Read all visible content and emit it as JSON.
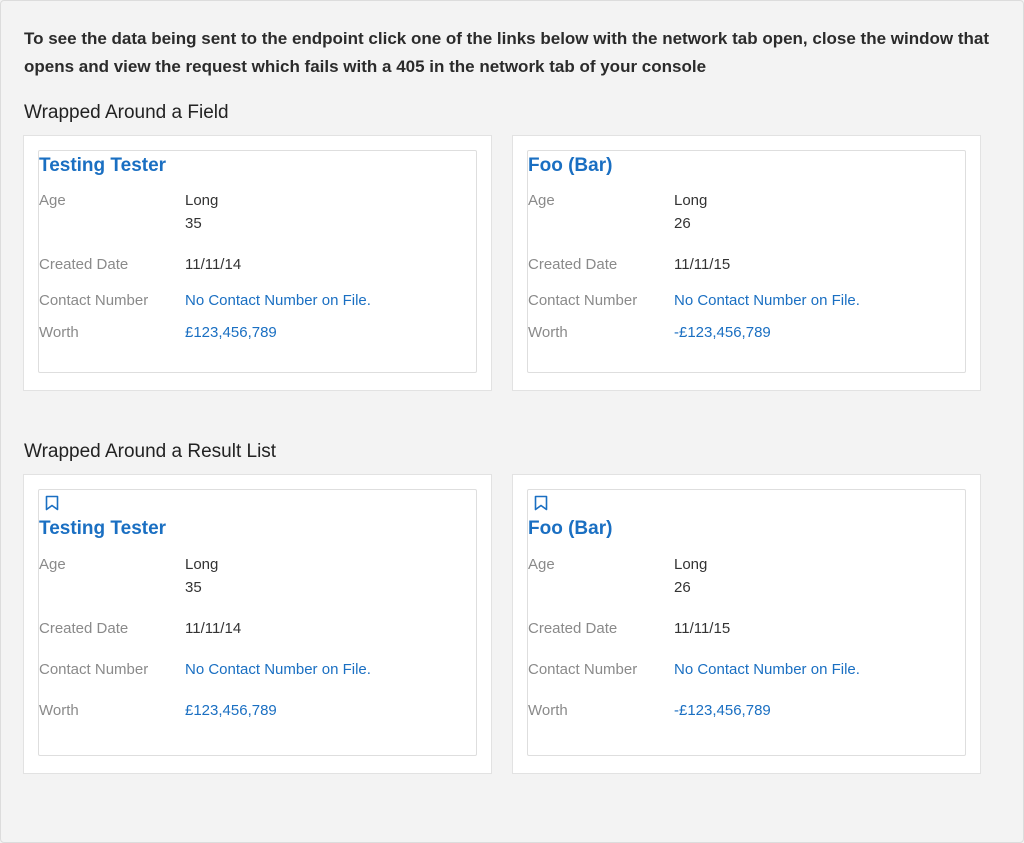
{
  "intro_text": "To see the data being sent to the endpoint click one of the links below with the network tab open, close the window that opens and view the request which fails with a 405 in the network tab of your console",
  "sections": [
    {
      "title": "Wrapped Around a Field",
      "cards": [
        {
          "name": "Testing Tester",
          "age_label": "Age",
          "age_value_1": "Long",
          "age_value_2": "35",
          "created_label": "Created Date",
          "created_value": "11/11/14",
          "contact_label": "Contact Number",
          "contact_value": "No Contact Number on File.",
          "worth_label": "Worth",
          "worth_value": "£123,456,789"
        },
        {
          "name": "Foo (Bar)",
          "age_label": "Age",
          "age_value_1": "Long",
          "age_value_2": "26",
          "created_label": "Created Date",
          "created_value": "11/11/15",
          "contact_label": "Contact Number",
          "contact_value": "No Contact Number on File.",
          "worth_label": "Worth",
          "worth_value": "-£123,456,789"
        }
      ]
    },
    {
      "title": "Wrapped Around a Result List",
      "cards": [
        {
          "icon": "bookmark-icon",
          "name": "Testing Tester",
          "age_label": "Age",
          "age_value_1": "Long",
          "age_value_2": "35",
          "created_label": "Created Date",
          "created_value": "11/11/14",
          "contact_label": "Contact Number",
          "contact_value": "No Contact Number on File.",
          "worth_label": "Worth",
          "worth_value": "£123,456,789"
        },
        {
          "icon": "bookmark-icon",
          "name": "Foo (Bar)",
          "age_label": "Age",
          "age_value_1": "Long",
          "age_value_2": "26",
          "created_label": "Created Date",
          "created_value": "11/11/15",
          "contact_label": "Contact Number",
          "contact_value": "No Contact Number on File.",
          "worth_label": "Worth",
          "worth_value": "-£123,456,789"
        }
      ]
    }
  ],
  "colors": {
    "link": "#1a6fc2",
    "label": "#8a8a8a",
    "background": "#f3f3f3"
  }
}
